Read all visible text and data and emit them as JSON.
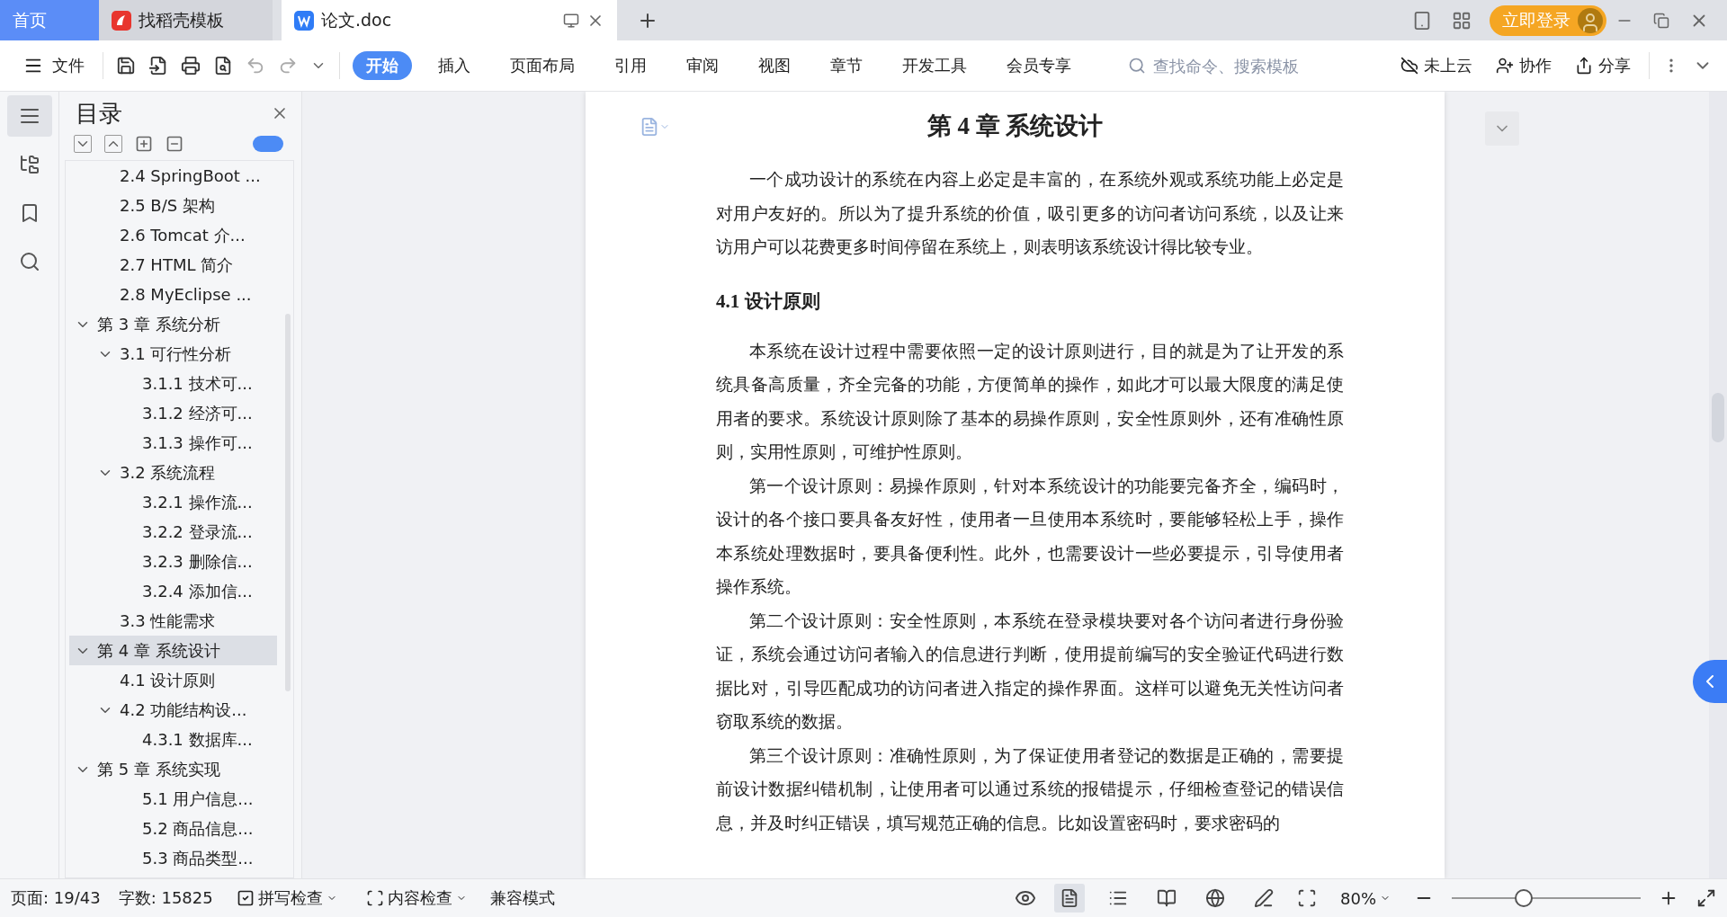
{
  "tabs": [
    {
      "label": "首页",
      "kind": "home",
      "selected": false
    },
    {
      "label": "找稻壳模板",
      "kind": "docer",
      "selected": false
    },
    {
      "label": "论文.doc",
      "kind": "doc",
      "selected": true
    }
  ],
  "login": "立即登录",
  "toolbar": {
    "file_menu": "文件",
    "ribbon_tabs": [
      {
        "label": "开始",
        "selected": true
      },
      {
        "label": "插入",
        "selected": false
      },
      {
        "label": "页面布局",
        "selected": false
      },
      {
        "label": "引用",
        "selected": false
      },
      {
        "label": "审阅",
        "selected": false
      },
      {
        "label": "视图",
        "selected": false
      },
      {
        "label": "章节",
        "selected": false
      },
      {
        "label": "开发工具",
        "selected": false
      },
      {
        "label": "会员专享",
        "selected": false
      }
    ],
    "search": {
      "placeholder": "查找命令、搜索模板"
    },
    "actions": [
      "未上云",
      "协作",
      "分享"
    ]
  },
  "rail": [
    {
      "selected": true
    },
    {
      "selected": false
    },
    {
      "selected": false
    },
    {
      "selected": false
    }
  ],
  "toc": {
    "title": "目录",
    "sync_toggle": {
      "on": true
    },
    "items": [
      {
        "children": [
          {
            "label": "2.4 SpringBoot ...",
            "selected": false
          },
          {
            "label": "2.5 B/S 架构",
            "selected": false
          },
          {
            "label": "2.6 Tomcat  介...",
            "selected": false
          },
          {
            "label": "2.7 HTML 简介",
            "selected": false
          },
          {
            "label": "2.8 MyEclipse ...",
            "selected": false
          }
        ]
      },
      {
        "label": "第 3 章  系统分析",
        "selected": false,
        "expanded": true,
        "children": [
          {
            "label": "3.1  可行性分析",
            "selected": false,
            "expanded": true,
            "children": [
              {
                "label": "3.1.1  技术可...",
                "selected": false
              },
              {
                "label": "3.1.2  经济可...",
                "selected": false
              },
              {
                "label": "3.1.3  操作可...",
                "selected": false
              }
            ]
          },
          {
            "label": "3.2  系统流程",
            "selected": false,
            "expanded": true,
            "children": [
              {
                "label": "3.2.1  操作流...",
                "selected": false
              },
              {
                "label": "3.2.2  登录流...",
                "selected": false
              },
              {
                "label": "3.2.3  删除信...",
                "selected": false
              },
              {
                "label": "3.2.4  添加信...",
                "selected": false
              }
            ]
          },
          {
            "label": "3.3  性能需求",
            "selected": false
          }
        ]
      },
      {
        "label": "第 4 章  系统设计",
        "selected": true,
        "expanded": true,
        "children": [
          {
            "label": "4.1  设计原则",
            "selected": false
          },
          {
            "label": "4.2  功能结构设...",
            "selected": false,
            "expanded": true,
            "children": [
              {
                "label": "4.3.1  数据库...",
                "selected": false
              }
            ]
          }
        ]
      },
      {
        "label": "第 5 章  系统实现",
        "selected": false,
        "expanded": true,
        "children": [
          {
            "children": [
              {
                "label": "5.1 用户信息...",
                "selected": false
              },
              {
                "label": "5.2  商品信息...",
                "selected": false
              },
              {
                "label": "5.3 商品类型...",
                "selected": false
              }
            ]
          }
        ]
      }
    ]
  },
  "document": {
    "chapter_title": "第 4 章  系统设计",
    "section_title": "4.1  设计原则",
    "intro": "一个成功设计的系统在内容上必定是丰富的，在系统外观或系统功能上必定是对用户友好的。所以为了提升系统的价值，吸引更多的访问者访问系统，以及让来访用户可以花费更多时间停留在系统上，则表明该系统设计得比较专业。",
    "paragraphs": [
      "本系统在设计过程中需要依照一定的设计原则进行，目的就是为了让开发的系统具备高质量，齐全完备的功能，方便简单的操作，如此才可以最大限度的满足使用者的要求。系统设计原则除了基本的易操作原则，安全性原则外，还有准确性原则，实用性原则，可维护性原则。",
      "第一个设计原则：易操作原则，针对本系统设计的功能要完备齐全，编码时，设计的各个接口要具备友好性，使用者一旦使用本系统时，要能够轻松上手，操作本系统处理数据时，要具备便利性。此外，也需要设计一些必要提示，引导使用者操作系统。",
      "第二个设计原则：安全性原则，本系统在登录模块要对各个访问者进行身份验证，系统会通过访问者输入的信息进行判断，使用提前编写的安全验证代码进行数据比对，引导匹配成功的访问者进入指定的操作界面。这样可以避免无关性访问者窃取系统的数据。",
      "第三个设计原则：准确性原则，为了保证使用者登记的数据是正确的，需要提前设计数据纠错机制，让使用者可以通过系统的报错提示，仔细检查登记的错误信息，并及时纠正错误，填写规范正确的信息。比如设置密码时，要求密码的"
    ]
  },
  "status": {
    "page": "页面: 19/43",
    "words": "字数: 15825",
    "checks": [
      "拼写检查",
      "内容检查"
    ],
    "mode": "兼容模式",
    "view_modes": [
      {
        "selected": true
      },
      {
        "selected": false
      },
      {
        "selected": false
      },
      {
        "selected": false
      },
      {
        "selected": false
      }
    ],
    "zoom": "80%",
    "zoom_slider": {
      "level": 0.38
    }
  }
}
